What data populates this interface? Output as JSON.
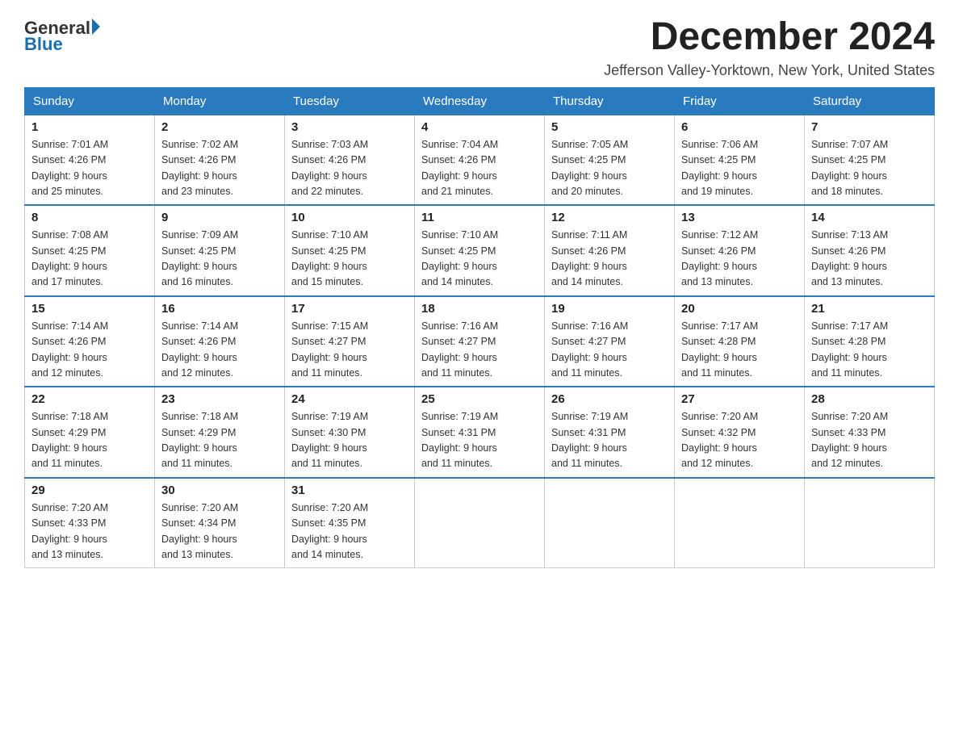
{
  "header": {
    "logo_general": "General",
    "logo_blue": "Blue",
    "month_title": "December 2024",
    "location": "Jefferson Valley-Yorktown, New York, United States"
  },
  "days_of_week": [
    "Sunday",
    "Monday",
    "Tuesday",
    "Wednesday",
    "Thursday",
    "Friday",
    "Saturday"
  ],
  "weeks": [
    [
      {
        "day": "1",
        "sunrise": "7:01 AM",
        "sunset": "4:26 PM",
        "daylight": "9 hours and 25 minutes."
      },
      {
        "day": "2",
        "sunrise": "7:02 AM",
        "sunset": "4:26 PM",
        "daylight": "9 hours and 23 minutes."
      },
      {
        "day": "3",
        "sunrise": "7:03 AM",
        "sunset": "4:26 PM",
        "daylight": "9 hours and 22 minutes."
      },
      {
        "day": "4",
        "sunrise": "7:04 AM",
        "sunset": "4:26 PM",
        "daylight": "9 hours and 21 minutes."
      },
      {
        "day": "5",
        "sunrise": "7:05 AM",
        "sunset": "4:25 PM",
        "daylight": "9 hours and 20 minutes."
      },
      {
        "day": "6",
        "sunrise": "7:06 AM",
        "sunset": "4:25 PM",
        "daylight": "9 hours and 19 minutes."
      },
      {
        "day": "7",
        "sunrise": "7:07 AM",
        "sunset": "4:25 PM",
        "daylight": "9 hours and 18 minutes."
      }
    ],
    [
      {
        "day": "8",
        "sunrise": "7:08 AM",
        "sunset": "4:25 PM",
        "daylight": "9 hours and 17 minutes."
      },
      {
        "day": "9",
        "sunrise": "7:09 AM",
        "sunset": "4:25 PM",
        "daylight": "9 hours and 16 minutes."
      },
      {
        "day": "10",
        "sunrise": "7:10 AM",
        "sunset": "4:25 PM",
        "daylight": "9 hours and 15 minutes."
      },
      {
        "day": "11",
        "sunrise": "7:10 AM",
        "sunset": "4:25 PM",
        "daylight": "9 hours and 14 minutes."
      },
      {
        "day": "12",
        "sunrise": "7:11 AM",
        "sunset": "4:26 PM",
        "daylight": "9 hours and 14 minutes."
      },
      {
        "day": "13",
        "sunrise": "7:12 AM",
        "sunset": "4:26 PM",
        "daylight": "9 hours and 13 minutes."
      },
      {
        "day": "14",
        "sunrise": "7:13 AM",
        "sunset": "4:26 PM",
        "daylight": "9 hours and 13 minutes."
      }
    ],
    [
      {
        "day": "15",
        "sunrise": "7:14 AM",
        "sunset": "4:26 PM",
        "daylight": "9 hours and 12 minutes."
      },
      {
        "day": "16",
        "sunrise": "7:14 AM",
        "sunset": "4:26 PM",
        "daylight": "9 hours and 12 minutes."
      },
      {
        "day": "17",
        "sunrise": "7:15 AM",
        "sunset": "4:27 PM",
        "daylight": "9 hours and 11 minutes."
      },
      {
        "day": "18",
        "sunrise": "7:16 AM",
        "sunset": "4:27 PM",
        "daylight": "9 hours and 11 minutes."
      },
      {
        "day": "19",
        "sunrise": "7:16 AM",
        "sunset": "4:27 PM",
        "daylight": "9 hours and 11 minutes."
      },
      {
        "day": "20",
        "sunrise": "7:17 AM",
        "sunset": "4:28 PM",
        "daylight": "9 hours and 11 minutes."
      },
      {
        "day": "21",
        "sunrise": "7:17 AM",
        "sunset": "4:28 PM",
        "daylight": "9 hours and 11 minutes."
      }
    ],
    [
      {
        "day": "22",
        "sunrise": "7:18 AM",
        "sunset": "4:29 PM",
        "daylight": "9 hours and 11 minutes."
      },
      {
        "day": "23",
        "sunrise": "7:18 AM",
        "sunset": "4:29 PM",
        "daylight": "9 hours and 11 minutes."
      },
      {
        "day": "24",
        "sunrise": "7:19 AM",
        "sunset": "4:30 PM",
        "daylight": "9 hours and 11 minutes."
      },
      {
        "day": "25",
        "sunrise": "7:19 AM",
        "sunset": "4:31 PM",
        "daylight": "9 hours and 11 minutes."
      },
      {
        "day": "26",
        "sunrise": "7:19 AM",
        "sunset": "4:31 PM",
        "daylight": "9 hours and 11 minutes."
      },
      {
        "day": "27",
        "sunrise": "7:20 AM",
        "sunset": "4:32 PM",
        "daylight": "9 hours and 12 minutes."
      },
      {
        "day": "28",
        "sunrise": "7:20 AM",
        "sunset": "4:33 PM",
        "daylight": "9 hours and 12 minutes."
      }
    ],
    [
      {
        "day": "29",
        "sunrise": "7:20 AM",
        "sunset": "4:33 PM",
        "daylight": "9 hours and 13 minutes."
      },
      {
        "day": "30",
        "sunrise": "7:20 AM",
        "sunset": "4:34 PM",
        "daylight": "9 hours and 13 minutes."
      },
      {
        "day": "31",
        "sunrise": "7:20 AM",
        "sunset": "4:35 PM",
        "daylight": "9 hours and 14 minutes."
      },
      null,
      null,
      null,
      null
    ]
  ],
  "labels": {
    "sunrise": "Sunrise:",
    "sunset": "Sunset:",
    "daylight": "Daylight:"
  }
}
